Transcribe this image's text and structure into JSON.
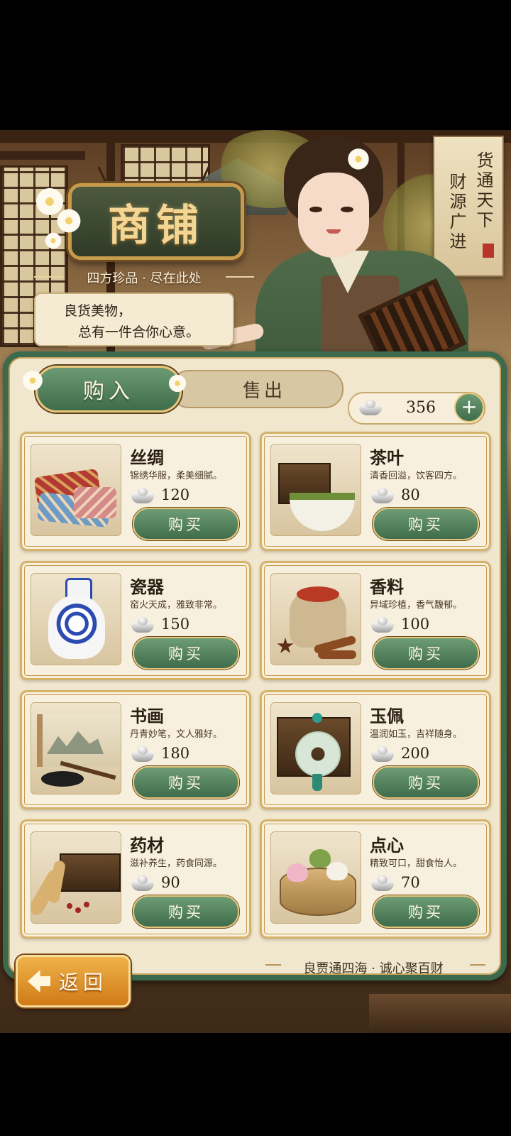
{
  "header": {
    "shop_title": "商铺",
    "subtitle": "四方珍品 · 尽在此处",
    "speech_line1": "良货美物，",
    "speech_line2": "总有一件合你心意。",
    "banner_col1": "货通天下",
    "banner_col2": "财源广进"
  },
  "tabs": {
    "buy": "购入",
    "sell": "售出",
    "active": "购入"
  },
  "currency": {
    "icon": "silver-ingot-icon",
    "amount": "356",
    "add": "+"
  },
  "items": [
    {
      "name": "丝绸",
      "desc": "锦绣华服，柔美细腻。",
      "price": "120",
      "button": "购买"
    },
    {
      "name": "茶叶",
      "desc": "清香回溢，饮客四方。",
      "price": "80",
      "button": "购买"
    },
    {
      "name": "瓷器",
      "desc": "窑火天成，雅致非常。",
      "price": "150",
      "button": "购买"
    },
    {
      "name": "香料",
      "desc": "异域珍植，香气馥郁。",
      "price": "100",
      "button": "购买"
    },
    {
      "name": "书画",
      "desc": "丹青妙笔，文人雅好。",
      "price": "180",
      "button": "购买"
    },
    {
      "name": "玉佩",
      "desc": "温润如玉，吉祥随身。",
      "price": "200",
      "button": "购买"
    },
    {
      "name": "药材",
      "desc": "滋补养生，药食同源。",
      "price": "90",
      "button": "购买"
    },
    {
      "name": "点心",
      "desc": "精致可口，甜食怡人。",
      "price": "70",
      "button": "购买"
    }
  ],
  "footer": {
    "back": "返回",
    "motto": "良贾通四海 · 诚心聚百财"
  },
  "colors": {
    "panel_border": "#3d6a4c",
    "button_green": "#4f7f5a",
    "gold_trim": "#d6b269",
    "back_orange": "#e0952a"
  }
}
